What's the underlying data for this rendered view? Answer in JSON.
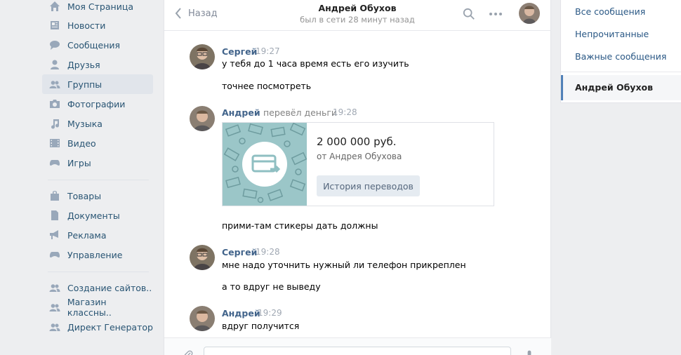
{
  "sidebar": {
    "items": [
      {
        "label": "Моя Страница",
        "icon": "home-icon"
      },
      {
        "label": "Новости",
        "icon": "news-icon"
      },
      {
        "label": "Сообщения",
        "icon": "messages-icon"
      },
      {
        "label": "Друзья",
        "icon": "friends-icon"
      },
      {
        "label": "Группы",
        "icon": "groups-icon",
        "active": true
      },
      {
        "label": "Фотографии",
        "icon": "camera-icon"
      },
      {
        "label": "Музыка",
        "icon": "music-icon"
      },
      {
        "label": "Видео",
        "icon": "video-icon"
      },
      {
        "label": "Игры",
        "icon": "gamepad-icon"
      },
      {
        "label": "Товары",
        "icon": "bag-icon"
      },
      {
        "label": "Документы",
        "icon": "document-icon"
      },
      {
        "label": "Реклама",
        "icon": "megaphone-icon"
      },
      {
        "label": "Управление",
        "icon": "gamepad-icon"
      },
      {
        "label": "Создание сайтов..",
        "icon": "community-icon"
      },
      {
        "label": "Магазин классны..",
        "icon": "community-icon"
      },
      {
        "label": "Директ Генератор",
        "icon": "community-icon"
      }
    ]
  },
  "chat": {
    "back_label": "Назад",
    "title": "Андрей Обухов",
    "subtitle": "был в сети 28 минут назад",
    "messages": [
      {
        "author": "Сергей",
        "time": "19:27",
        "lines": [
          "у тебя до 1 часа время есть его изучить",
          "точнее посмотреть"
        ]
      },
      {
        "author": "Андрей",
        "action": "перевёл деньги",
        "time": "19:28"
      },
      {
        "text": "прими-там стикеры дать должны"
      },
      {
        "author": "Сергей",
        "time": "19:28",
        "lines": [
          "мне надо уточнить нужный ли телефон прикреплен",
          "а то вдруг не выведу"
        ]
      },
      {
        "author": "Андрей",
        "time": "19:29",
        "lines": [
          "вдруг получится"
        ]
      }
    ],
    "transfer": {
      "amount": "2 000 000 руб.",
      "from": "от Андрея Обухова",
      "button": "История переводов"
    }
  },
  "folders": {
    "all": "Все сообщения",
    "unread": "Непрочитанные",
    "important": "Важные сообщения",
    "active_chat": "Андрей Обухов"
  },
  "colors": {
    "link": "#2a5885",
    "author": "#42648b",
    "accent": "#5181b8",
    "background": "#edeef0"
  }
}
